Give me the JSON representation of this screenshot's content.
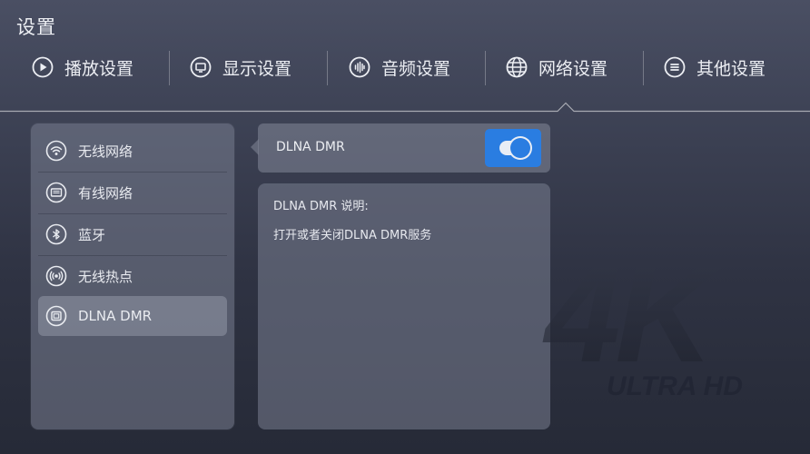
{
  "page_title": "设置",
  "tabs": [
    {
      "label": "播放设置",
      "icon": "play-icon"
    },
    {
      "label": "显示设置",
      "icon": "display-icon"
    },
    {
      "label": "音频设置",
      "icon": "audio-icon"
    },
    {
      "label": "网络设置",
      "icon": "globe-icon",
      "selected": true
    },
    {
      "label": "其他设置",
      "icon": "menu-icon"
    }
  ],
  "sidebar": {
    "items": [
      {
        "label": "无线网络",
        "icon": "wifi-icon"
      },
      {
        "label": "有线网络",
        "icon": "ethernet-icon"
      },
      {
        "label": "蓝牙",
        "icon": "bluetooth-icon"
      },
      {
        "label": "无线热点",
        "icon": "hotspot-icon"
      },
      {
        "label": "DLNA DMR",
        "icon": "dlna-icon",
        "selected": true
      }
    ]
  },
  "setting": {
    "label": "DLNA DMR",
    "enabled": true
  },
  "description": {
    "title": "DLNA DMR 说明:",
    "text": "打开或者关闭DLNA DMR服务"
  },
  "watermark": {
    "big_text": "4K",
    "small_text": "ULTRA HD"
  },
  "colors": {
    "accent": "#2a7de1",
    "panel": "#7d8292",
    "background_top": "#4a4f63",
    "background_bottom": "#262a37"
  }
}
